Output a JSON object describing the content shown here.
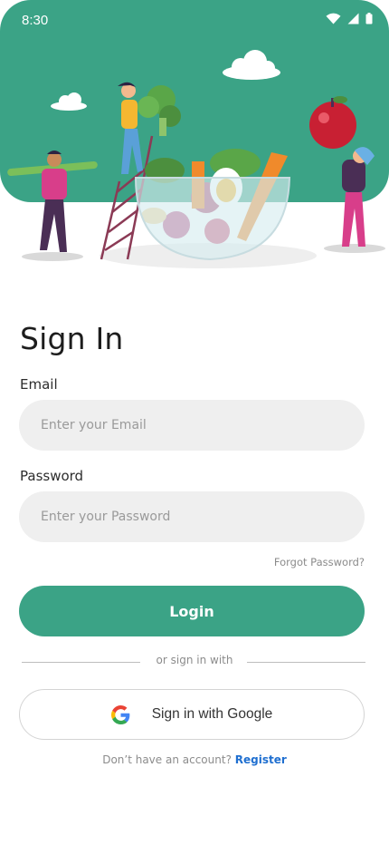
{
  "status_bar": {
    "time": "8:30",
    "icons": [
      "wifi-icon",
      "signal-icon",
      "battery-icon"
    ]
  },
  "hero": {
    "illustration": "people-gathering-vegetables-salad-bowl",
    "background_color": "#3ba386"
  },
  "form": {
    "title": "Sign In",
    "email": {
      "label": "Email",
      "placeholder": "Enter your Email",
      "value": ""
    },
    "password": {
      "label": "Password",
      "placeholder": "Enter your Password",
      "value": ""
    },
    "forgot_label": "Forgot Password?",
    "login_label": "Login",
    "divider_text": "or sign in with",
    "google_label": "Sign in with Google",
    "register_prompt": "Don’t have an account?",
    "register_link": "Register"
  },
  "colors": {
    "accent": "#3ba386",
    "link": "#1f6fd0"
  }
}
